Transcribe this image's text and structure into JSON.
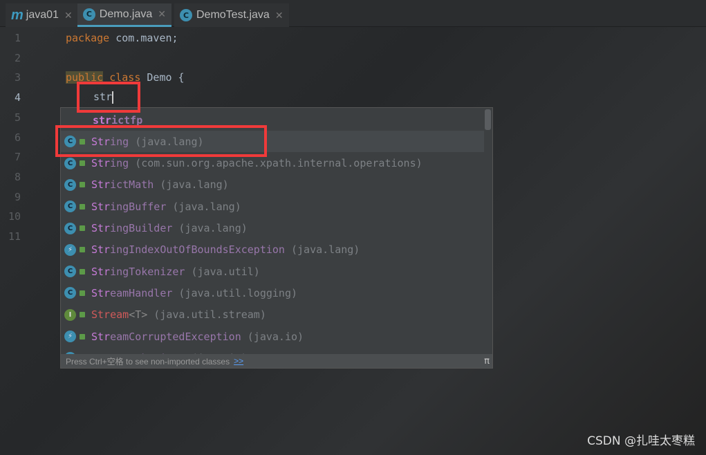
{
  "tabs": [
    {
      "label": "java01",
      "icon": "maven-icon"
    },
    {
      "label": "Demo.java",
      "icon": "class-icon",
      "active": true
    },
    {
      "label": "DemoTest.java",
      "icon": "class-icon"
    }
  ],
  "gutter": {
    "lines": [
      "1",
      "2",
      "3",
      "4",
      "5",
      "6",
      "7",
      "8",
      "9",
      "10",
      "11"
    ]
  },
  "code": {
    "line1_kw": "package",
    "line1_rest": " com.maven;",
    "line3_kw1": "public",
    "line3_kw2": " class",
    "line3_rest": " Demo {",
    "line4": "str"
  },
  "completion": {
    "items": [
      {
        "match": "str",
        "rest": "ictfp",
        "pkg": "",
        "icon": ""
      },
      {
        "match": "Str",
        "rest": "ing",
        "pkg": " (java.lang)",
        "icon": "class-icon"
      },
      {
        "match": "Str",
        "rest": "ing",
        "pkg": " (com.sun.org.apache.xpath.internal.operations)",
        "icon": "class-icon"
      },
      {
        "match": "Str",
        "rest": "ictMath",
        "pkg": " (java.lang)",
        "icon": "class-icon"
      },
      {
        "match": "Str",
        "rest": "ingBuffer",
        "pkg": " (java.lang)",
        "icon": "class-icon"
      },
      {
        "match": "Str",
        "rest": "ingBuilder",
        "pkg": " (java.lang)",
        "icon": "class-icon"
      },
      {
        "match": "Str",
        "rest": "ingIndexOutOfBoundsException",
        "pkg": " (java.lang)",
        "icon": "exception-icon"
      },
      {
        "match": "Str",
        "rest": "ingTokenizer",
        "pkg": " (java.util)",
        "icon": "class-icon"
      },
      {
        "match": "Str",
        "rest": "eamHandler",
        "pkg": " (java.util.logging)",
        "icon": "class-icon"
      },
      {
        "match": "Str",
        "rest": "eam",
        "generic": "<T>",
        "pkg": " (java.util.stream)",
        "icon": "interface-icon"
      },
      {
        "match": "Str",
        "rest": "eamCorruptedException",
        "pkg": " (java.io)",
        "icon": "exception-icon"
      },
      {
        "match": "Str",
        "rest": "eamTokenizer",
        "pkg": " (java.io)",
        "icon": "class-icon"
      }
    ],
    "footer": "Press Ctrl+空格 to see non-imported classes",
    "footer_link": ">>",
    "pi": "π"
  },
  "watermark": "CSDN @扎哇太枣糕",
  "colors": {
    "highlight_box": "#f03a3a",
    "accent": "#4a9dbd"
  }
}
